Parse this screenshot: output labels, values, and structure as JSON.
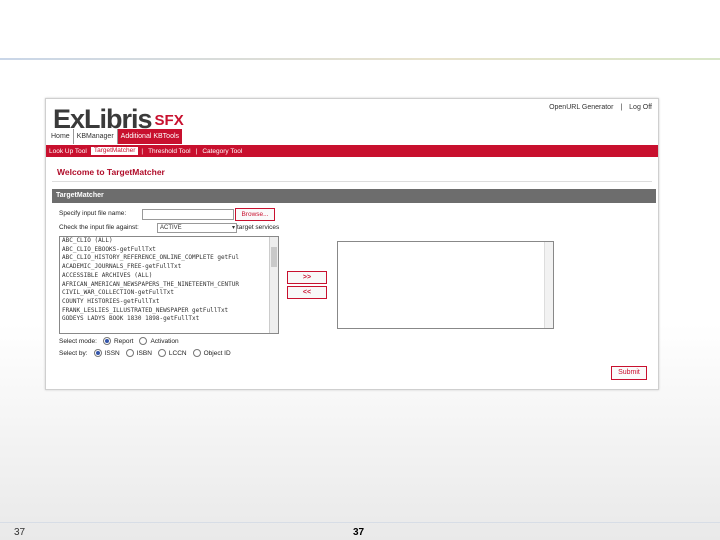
{
  "slide": {
    "number_left": "37",
    "number_center": "37"
  },
  "app": {
    "logo_main": "ExLibris",
    "logo_product": "SFX",
    "top_links": [
      "OpenURL Generator",
      "|",
      "Log Off"
    ]
  },
  "tabs": [
    {
      "label": "Home"
    },
    {
      "label": "KBManager"
    },
    {
      "label": "Additional KBTools"
    }
  ],
  "subnav": [
    {
      "label": "Look Up Tool"
    },
    {
      "label": "TargetMatcher"
    },
    {
      "label": "Threshold Tool"
    },
    {
      "label": "Category Tool"
    }
  ],
  "page": {
    "welcome": "Welcome to TargetMatcher",
    "section_title": "TargetMatcher"
  },
  "form": {
    "specify_label": "Specify input file name:",
    "browse_label": "Browse...",
    "check_label": "Check the input file against:",
    "check_value": "ACTIVE",
    "check_suffix": "target services",
    "move_right": ">>",
    "move_left": "<<",
    "list_items": [
      "ABC_CLIO (ALL)",
      "ABC_CLIO_EBOOKS-getFullTxt",
      "ABC_CLIO_HISTORY_REFERENCE_ONLINE_COMPLETE getFul",
      "ACADEMIC_JOURNALS_FREE-getFullTxt",
      "ACCESSIBLE ARCHIVES (ALL)",
      "AFRICAN_AMERICAN_NEWSPAPERS_THE_NINETEENTH_CENTUR",
      "CIVIL_WAR_COLLECTION-getFullTxt",
      "COUNTY HISTORIES-getFullTxt",
      "FRANK_LESLIES_ILLUSTRATED_NEWSPAPER getFullTxt",
      "GODEYS LADYS BOOK 1830 1898-getFullTxt"
    ],
    "mode_label": "Select mode:",
    "mode_options": [
      {
        "label": "Report",
        "selected": true
      },
      {
        "label": "Activation",
        "selected": false
      }
    ],
    "by_label": "Select by:",
    "by_options": [
      {
        "label": "ISSN",
        "selected": true
      },
      {
        "label": "ISBN",
        "selected": false
      },
      {
        "label": "LCCN",
        "selected": false
      },
      {
        "label": "Object ID",
        "selected": false
      }
    ],
    "submit_label": "Submit"
  },
  "colors": {
    "brand": "#c8102e",
    "section_bar": "#6d6d6d"
  }
}
